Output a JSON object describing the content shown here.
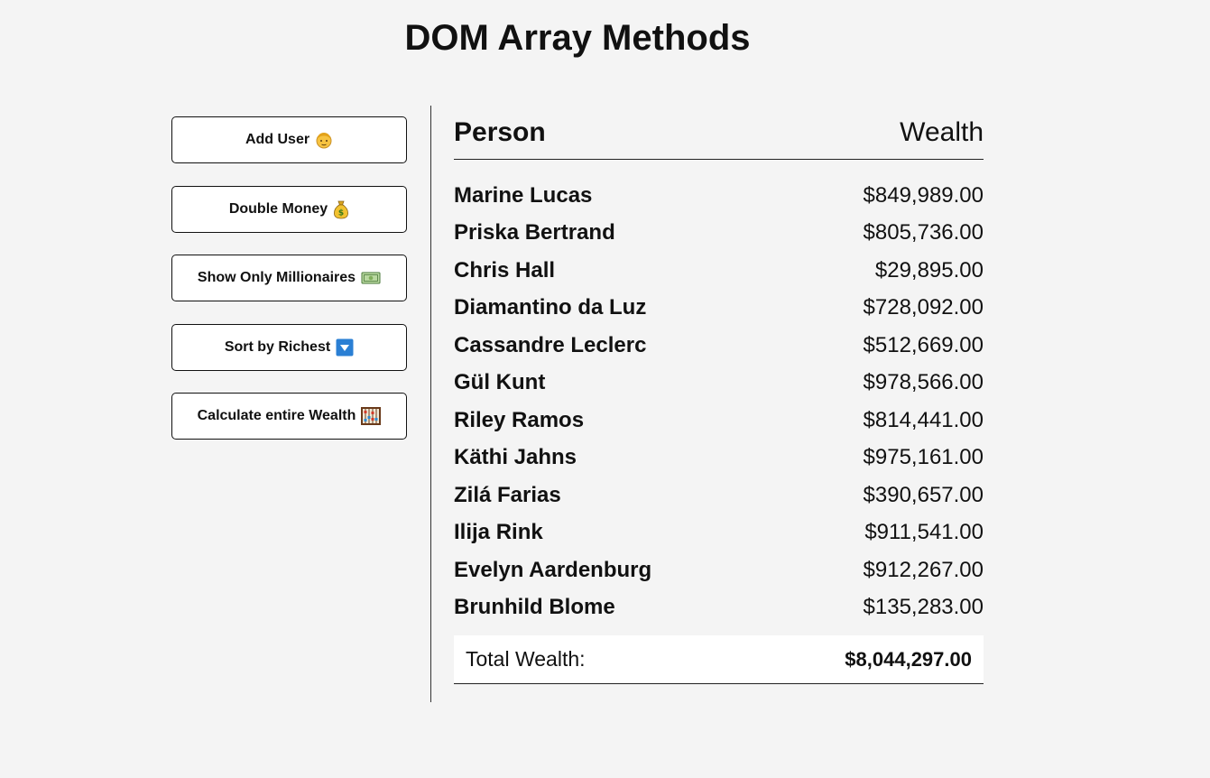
{
  "page": {
    "title": "DOM Array Methods"
  },
  "buttons": [
    {
      "label": "Add User",
      "icon": "man-face-icon"
    },
    {
      "label": "Double Money",
      "icon": "money-bag-icon"
    },
    {
      "label": "Show Only Millionaires",
      "icon": "banknote-icon"
    },
    {
      "label": "Sort by Richest",
      "icon": "down-arrow-icon"
    },
    {
      "label": "Calculate entire Wealth",
      "icon": "abacus-icon"
    }
  ],
  "table": {
    "headers": {
      "person": "Person",
      "wealth": "Wealth"
    },
    "rows": [
      {
        "name": "Marine Lucas",
        "wealth": "$849,989.00"
      },
      {
        "name": "Priska Bertrand",
        "wealth": "$805,736.00"
      },
      {
        "name": "Chris Hall",
        "wealth": "$29,895.00"
      },
      {
        "name": "Diamantino da Luz",
        "wealth": "$728,092.00"
      },
      {
        "name": "Cassandre Leclerc",
        "wealth": "$512,669.00"
      },
      {
        "name": "Gül Kunt",
        "wealth": "$978,566.00"
      },
      {
        "name": "Riley Ramos",
        "wealth": "$814,441.00"
      },
      {
        "name": "Käthi Jahns",
        "wealth": "$975,161.00"
      },
      {
        "name": "Zilá Farias",
        "wealth": "$390,657.00"
      },
      {
        "name": "Ilija Rink",
        "wealth": "$911,541.00"
      },
      {
        "name": "Evelyn Aardenburg",
        "wealth": "$912,267.00"
      },
      {
        "name": "Brunhild Blome",
        "wealth": "$135,283.00"
      }
    ],
    "total": {
      "label": "Total Wealth:",
      "value": "$8,044,297.00"
    }
  },
  "colors": {
    "background": "#f4f4f4",
    "button_bg": "#ffffff",
    "text": "#111111",
    "sort_icon_blue": "#2a7fd4"
  }
}
